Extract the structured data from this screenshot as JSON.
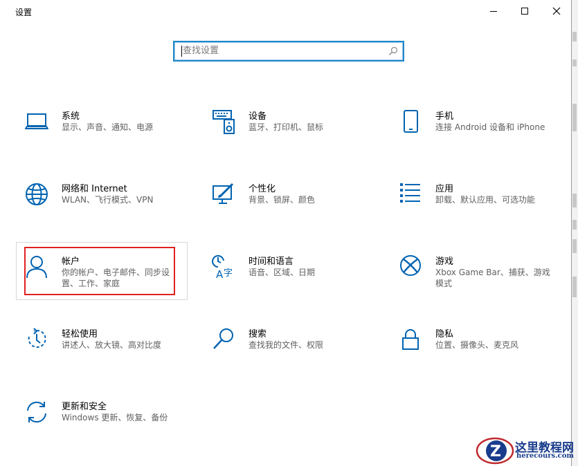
{
  "window": {
    "title": "设置"
  },
  "controls": {
    "minimize": "minimize-icon",
    "maximize": "maximize-icon",
    "close": "close-icon"
  },
  "search": {
    "placeholder": "查找设置"
  },
  "accent": "#0063b1",
  "tiles": [
    {
      "name": "系统",
      "desc": "显示、声音、通知、电源",
      "icon": "laptop-icon"
    },
    {
      "name": "设备",
      "desc": "蓝牙、打印机、鼠标",
      "icon": "keyboard-speaker-icon"
    },
    {
      "name": "手机",
      "desc": "连接 Android 设备和 iPhone",
      "icon": "phone-icon"
    },
    {
      "name": "网络和 Internet",
      "desc": "WLAN、飞行模式、VPN",
      "icon": "globe-icon"
    },
    {
      "name": "个性化",
      "desc": "背景、锁屏、颜色",
      "icon": "paint-icon"
    },
    {
      "name": "应用",
      "desc": "卸载、默认应用、可选功能",
      "icon": "apps-list-icon"
    },
    {
      "name": "帐户",
      "desc": "你的帐户、电子邮件、同步设置、工作、家庭",
      "icon": "person-icon"
    },
    {
      "name": "时间和语言",
      "desc": "语音、区域、日期",
      "icon": "time-language-icon"
    },
    {
      "name": "游戏",
      "desc": "Xbox Game Bar、捕获、游戏模式",
      "icon": "xbox-icon"
    },
    {
      "name": "轻松使用",
      "desc": "讲述人、放大镜、高对比度",
      "icon": "ease-of-access-icon"
    },
    {
      "name": "搜索",
      "desc": "查找我的文件、权限",
      "icon": "search-icon"
    },
    {
      "name": "隐私",
      "desc": "位置、摄像头、麦克风",
      "icon": "lock-icon"
    },
    {
      "name": "更新和安全",
      "desc": "Windows 更新、恢复、备份",
      "icon": "sync-icon"
    }
  ],
  "watermark": {
    "title": "这里教程网",
    "url": "herecours.com"
  }
}
